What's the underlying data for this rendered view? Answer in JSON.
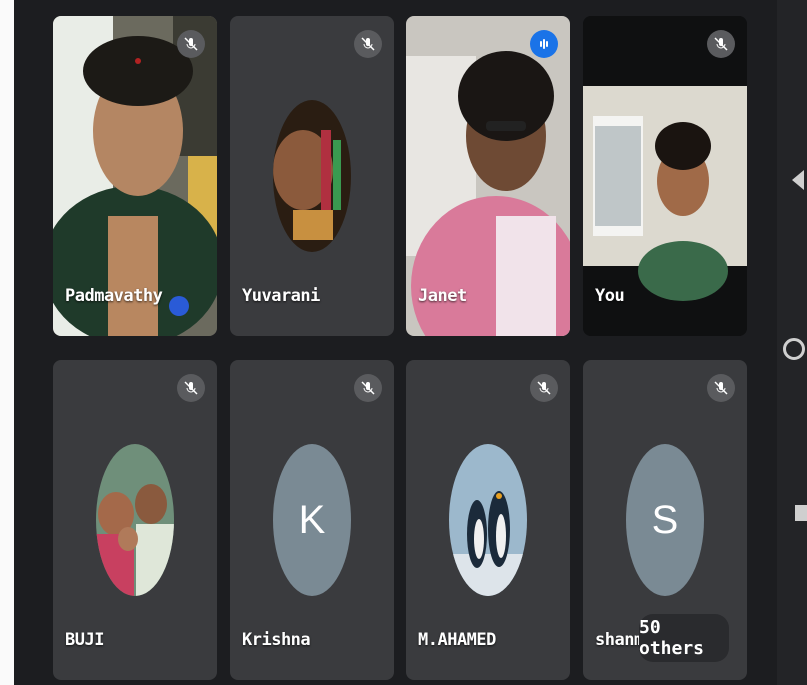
{
  "participants": [
    {
      "name": "Padmavathy",
      "mic": "muted-mic-icon"
    },
    {
      "name": "Yuvarani",
      "mic": "muted-mic-icon"
    },
    {
      "name": "Janet",
      "mic": "speaking-indicator-icon"
    },
    {
      "name": "You",
      "mic": "muted-mic-icon"
    },
    {
      "name": "BUJI",
      "mic": "muted-mic-icon"
    },
    {
      "name": "Krishna",
      "mic": "muted-mic-icon",
      "avatar_letter": "K"
    },
    {
      "name": "M.AHAMED",
      "mic": "muted-mic-icon"
    },
    {
      "name": "shanmug",
      "mic": "muted-mic-icon",
      "avatar_letter": "S"
    }
  ],
  "others_label": "50 others",
  "colors": {
    "tile_bg": "#3a3b3e",
    "speaking": "#1a73e8",
    "letter_avatar": "#7a8a94"
  }
}
